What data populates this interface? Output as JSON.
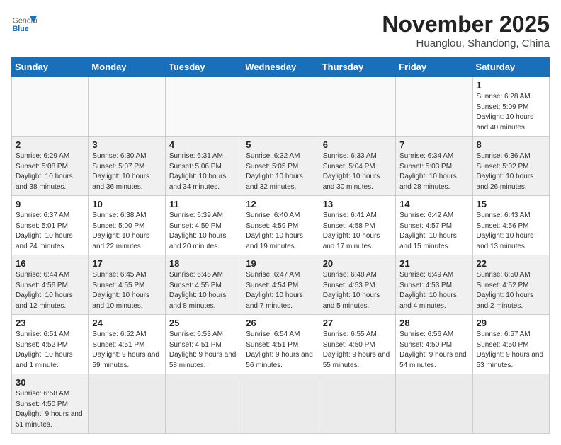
{
  "header": {
    "logo_general": "General",
    "logo_blue": "Blue",
    "month_year": "November 2025",
    "location": "Huanglou, Shandong, China"
  },
  "weekdays": [
    "Sunday",
    "Monday",
    "Tuesday",
    "Wednesday",
    "Thursday",
    "Friday",
    "Saturday"
  ],
  "weeks": [
    [
      {
        "day": "",
        "info": ""
      },
      {
        "day": "",
        "info": ""
      },
      {
        "day": "",
        "info": ""
      },
      {
        "day": "",
        "info": ""
      },
      {
        "day": "",
        "info": ""
      },
      {
        "day": "",
        "info": ""
      },
      {
        "day": "1",
        "info": "Sunrise: 6:28 AM\nSunset: 5:09 PM\nDaylight: 10 hours and 40 minutes."
      }
    ],
    [
      {
        "day": "2",
        "info": "Sunrise: 6:29 AM\nSunset: 5:08 PM\nDaylight: 10 hours and 38 minutes."
      },
      {
        "day": "3",
        "info": "Sunrise: 6:30 AM\nSunset: 5:07 PM\nDaylight: 10 hours and 36 minutes."
      },
      {
        "day": "4",
        "info": "Sunrise: 6:31 AM\nSunset: 5:06 PM\nDaylight: 10 hours and 34 minutes."
      },
      {
        "day": "5",
        "info": "Sunrise: 6:32 AM\nSunset: 5:05 PM\nDaylight: 10 hours and 32 minutes."
      },
      {
        "day": "6",
        "info": "Sunrise: 6:33 AM\nSunset: 5:04 PM\nDaylight: 10 hours and 30 minutes."
      },
      {
        "day": "7",
        "info": "Sunrise: 6:34 AM\nSunset: 5:03 PM\nDaylight: 10 hours and 28 minutes."
      },
      {
        "day": "8",
        "info": "Sunrise: 6:36 AM\nSunset: 5:02 PM\nDaylight: 10 hours and 26 minutes."
      }
    ],
    [
      {
        "day": "9",
        "info": "Sunrise: 6:37 AM\nSunset: 5:01 PM\nDaylight: 10 hours and 24 minutes."
      },
      {
        "day": "10",
        "info": "Sunrise: 6:38 AM\nSunset: 5:00 PM\nDaylight: 10 hours and 22 minutes."
      },
      {
        "day": "11",
        "info": "Sunrise: 6:39 AM\nSunset: 4:59 PM\nDaylight: 10 hours and 20 minutes."
      },
      {
        "day": "12",
        "info": "Sunrise: 6:40 AM\nSunset: 4:59 PM\nDaylight: 10 hours and 19 minutes."
      },
      {
        "day": "13",
        "info": "Sunrise: 6:41 AM\nSunset: 4:58 PM\nDaylight: 10 hours and 17 minutes."
      },
      {
        "day": "14",
        "info": "Sunrise: 6:42 AM\nSunset: 4:57 PM\nDaylight: 10 hours and 15 minutes."
      },
      {
        "day": "15",
        "info": "Sunrise: 6:43 AM\nSunset: 4:56 PM\nDaylight: 10 hours and 13 minutes."
      }
    ],
    [
      {
        "day": "16",
        "info": "Sunrise: 6:44 AM\nSunset: 4:56 PM\nDaylight: 10 hours and 12 minutes."
      },
      {
        "day": "17",
        "info": "Sunrise: 6:45 AM\nSunset: 4:55 PM\nDaylight: 10 hours and 10 minutes."
      },
      {
        "day": "18",
        "info": "Sunrise: 6:46 AM\nSunset: 4:55 PM\nDaylight: 10 hours and 8 minutes."
      },
      {
        "day": "19",
        "info": "Sunrise: 6:47 AM\nSunset: 4:54 PM\nDaylight: 10 hours and 7 minutes."
      },
      {
        "day": "20",
        "info": "Sunrise: 6:48 AM\nSunset: 4:53 PM\nDaylight: 10 hours and 5 minutes."
      },
      {
        "day": "21",
        "info": "Sunrise: 6:49 AM\nSunset: 4:53 PM\nDaylight: 10 hours and 4 minutes."
      },
      {
        "day": "22",
        "info": "Sunrise: 6:50 AM\nSunset: 4:52 PM\nDaylight: 10 hours and 2 minutes."
      }
    ],
    [
      {
        "day": "23",
        "info": "Sunrise: 6:51 AM\nSunset: 4:52 PM\nDaylight: 10 hours and 1 minute."
      },
      {
        "day": "24",
        "info": "Sunrise: 6:52 AM\nSunset: 4:51 PM\nDaylight: 9 hours and 59 minutes."
      },
      {
        "day": "25",
        "info": "Sunrise: 6:53 AM\nSunset: 4:51 PM\nDaylight: 9 hours and 58 minutes."
      },
      {
        "day": "26",
        "info": "Sunrise: 6:54 AM\nSunset: 4:51 PM\nDaylight: 9 hours and 56 minutes."
      },
      {
        "day": "27",
        "info": "Sunrise: 6:55 AM\nSunset: 4:50 PM\nDaylight: 9 hours and 55 minutes."
      },
      {
        "day": "28",
        "info": "Sunrise: 6:56 AM\nSunset: 4:50 PM\nDaylight: 9 hours and 54 minutes."
      },
      {
        "day": "29",
        "info": "Sunrise: 6:57 AM\nSunset: 4:50 PM\nDaylight: 9 hours and 53 minutes."
      }
    ],
    [
      {
        "day": "30",
        "info": "Sunrise: 6:58 AM\nSunset: 4:50 PM\nDaylight: 9 hours and 51 minutes."
      },
      {
        "day": "",
        "info": ""
      },
      {
        "day": "",
        "info": ""
      },
      {
        "day": "",
        "info": ""
      },
      {
        "day": "",
        "info": ""
      },
      {
        "day": "",
        "info": ""
      },
      {
        "day": "",
        "info": ""
      }
    ]
  ]
}
